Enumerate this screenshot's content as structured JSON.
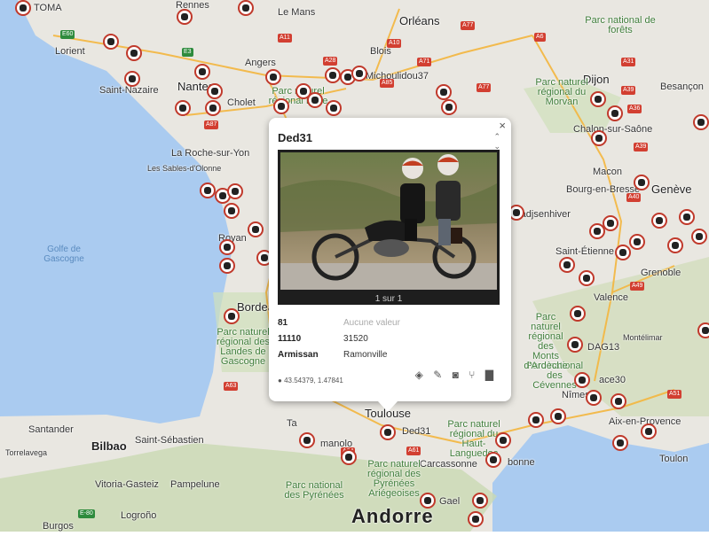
{
  "map": {
    "places": {
      "toma": "TOMA",
      "lorient": "Lorient",
      "saint_nazaire": "Saint-Nazaire",
      "nantes": "Nantes",
      "la_roche": "La Roche-sur-Yon",
      "sables": "Les Sables-d'Olonne",
      "royan": "Royan",
      "bordeaux": "Bordeaux",
      "golfe": "Golfe de Gascogne",
      "santander": "Santander",
      "bilbao": "Bilbao",
      "saint_seb": "Saint-Sébastien",
      "torrelavega": "Torrelavega",
      "vitoria": "Vitoria-Gasteiz",
      "pampelune": "Pampelune",
      "logrono": "Logroño",
      "burgos": "Burgos",
      "le_mans": "Le Mans",
      "orleans": "Orléans",
      "blois": "Blois",
      "angers": "Angers",
      "cholet": "Cholet",
      "michouli": "Michoulidou37",
      "rennes": "Rennes",
      "dijon": "Dijon",
      "besancon": "Besançon",
      "chalon": "Chalon-sur-Saône",
      "macon": "Macon",
      "bourg": "Bourg-en-Bresse",
      "geneve": "Genève",
      "saint_etienne": "Saint-Étienne",
      "grenoble": "Grenoble",
      "valence": "Valence",
      "montelimar": "Montélimar",
      "nimes": "Nîmes",
      "aix": "Aix-en-Provence",
      "toulon": "Toulon",
      "carcassonne": "Carcassonne",
      "andorre": "Andorre",
      "manolo": "manolo",
      "ded31": "Ded31",
      "bonne": "bonne",
      "ta": "Ta",
      "ace30": "ace30",
      "dag13": "DAG13",
      "gael": "Gael",
      "radjsen": "radjsenhiver",
      "toulouse": "Toulouse"
    },
    "parks": {
      "forets": "Parc national de forêts",
      "morvan": "Parc naturel régional du Morvan",
      "loire": "Parc naturel régional Loire",
      "landes": "Parc naturel régional des Landes de Gascogne",
      "haut_languedoc": "Parc naturel régional du Haut-Languedoc",
      "pyrenees": "Parc national des Pyrénées",
      "pyrenees_ariegeoises": "Parc naturel régional des Pyrénées Ariégeoises",
      "cevennes": "Parc national des Cévennes",
      "ardeche": "Parc naturel régional des Monts d'Ardèche"
    },
    "roads": [
      "E60",
      "A11",
      "A10",
      "A77",
      "A6",
      "A31",
      "E3",
      "A28",
      "A85",
      "A71",
      "A77",
      "A39",
      "A36",
      "A39",
      "A40",
      "A49",
      "A63",
      "A64",
      "A61",
      "A51",
      "A87",
      "E-80"
    ]
  },
  "popup": {
    "title": "Ded31",
    "close_icon": "×",
    "up_icon": "⌃",
    "down_icon": "⌄",
    "photo_counter": "1 sur 1",
    "rows": [
      {
        "key": "81",
        "value": "Aucune valeur",
        "muted": true
      },
      {
        "key": "11110",
        "value": "31520",
        "muted": false
      },
      {
        "key": "Armissan",
        "value": "Ramonville",
        "muted": false
      }
    ],
    "coords": "43.54379, 1.47841",
    "tools": [
      "paint-bucket-icon",
      "pencil-icon",
      "camera-icon",
      "directions-icon",
      "trash-icon"
    ]
  },
  "colors": {
    "marker_border": "#c0392b",
    "sea": "#aacbf0",
    "land": "#e8e6e0"
  }
}
